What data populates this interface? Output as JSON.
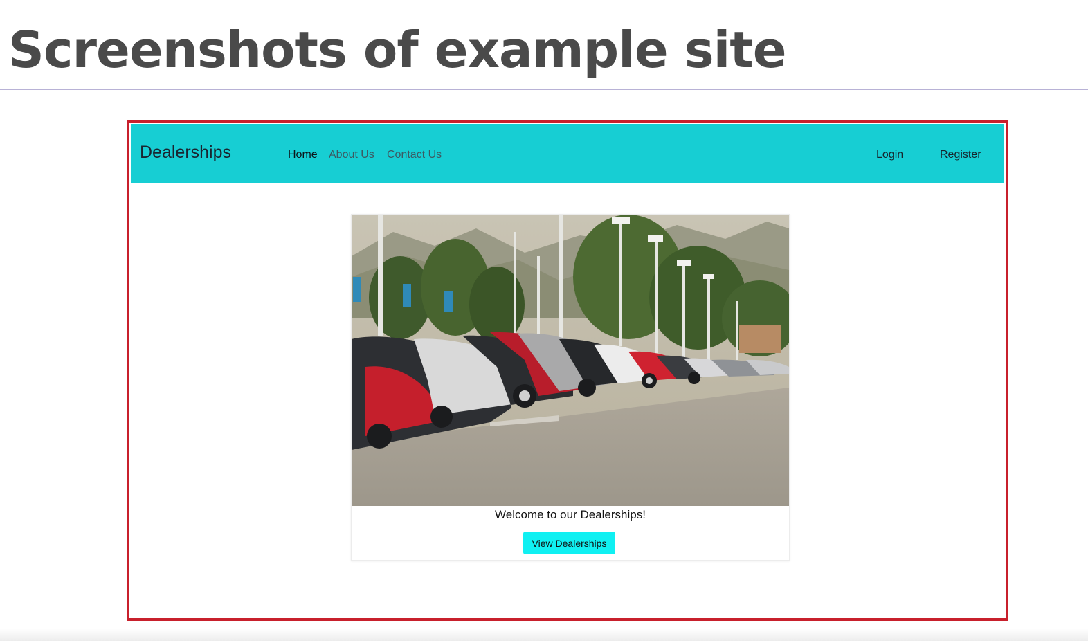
{
  "slide": {
    "title": "Screenshots of example site"
  },
  "site": {
    "brand": "Dealerships",
    "nav": {
      "home": "Home",
      "about": "About Us",
      "contact": "Contact Us",
      "login": "Login",
      "register": "Register"
    },
    "hero": {
      "welcome": "Welcome to our Dealerships!",
      "button": "View Dealerships",
      "image_alt": "car-dealership-lot-photo"
    }
  },
  "colors": {
    "navbar": "#17ced3",
    "frame_border": "#c8202c",
    "button": "#10f0f2",
    "title_text": "#4a4a4a"
  }
}
